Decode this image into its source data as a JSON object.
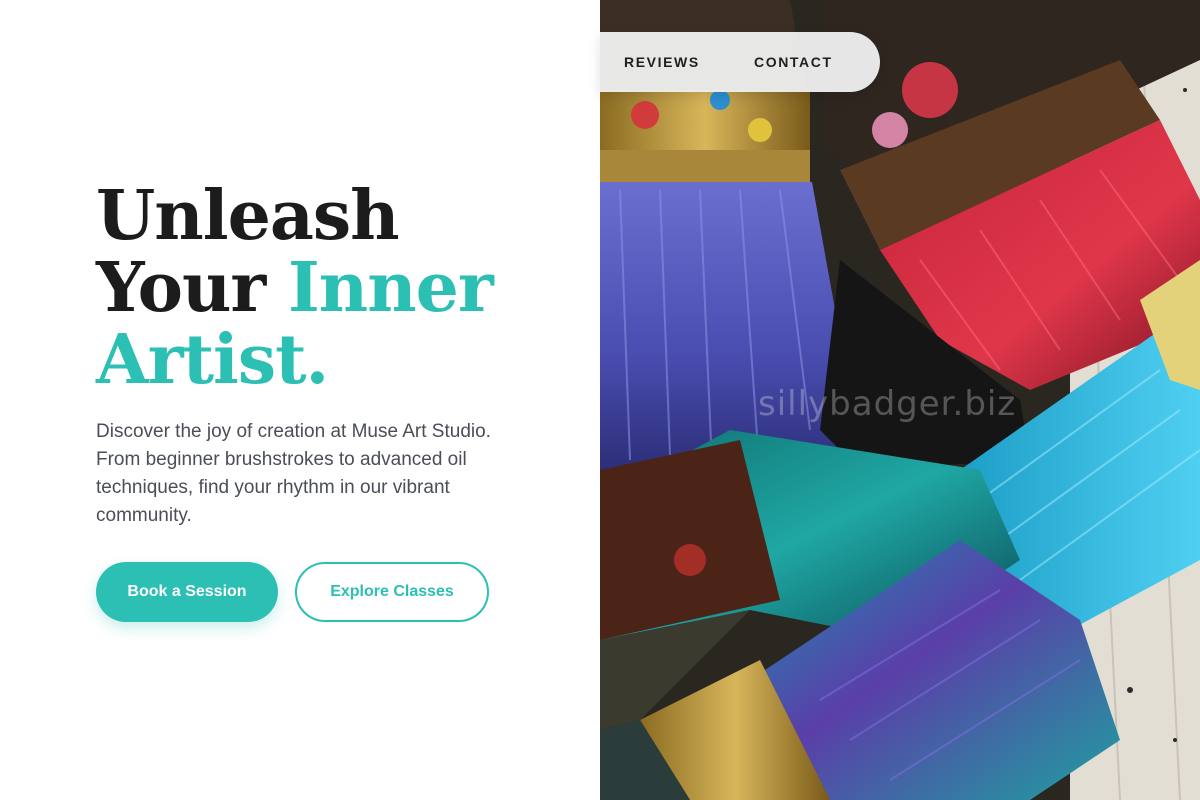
{
  "nav": {
    "reviews_label": "REVIEWS",
    "contact_label": "CONTACT"
  },
  "hero": {
    "headline_line1": "Unleash",
    "headline_line2_plain": "Your",
    "headline_line2_accent": "Inner",
    "headline_line3_accent": "Artist.",
    "description": "Discover the joy of creation at Muse Art Studio. From beginner brushstrokes to advanced oil techniques, find your rhythm in our vibrant community.",
    "primary_button_label": "Book a Session",
    "secondary_button_label": "Explore Classes"
  },
  "image": {
    "subject": "paint brushes",
    "watermark_text": "sillybadger.biz"
  },
  "colors": {
    "accent": "#2cbfb3",
    "headline": "#1c1c1c",
    "body_text": "#4a4e57"
  }
}
